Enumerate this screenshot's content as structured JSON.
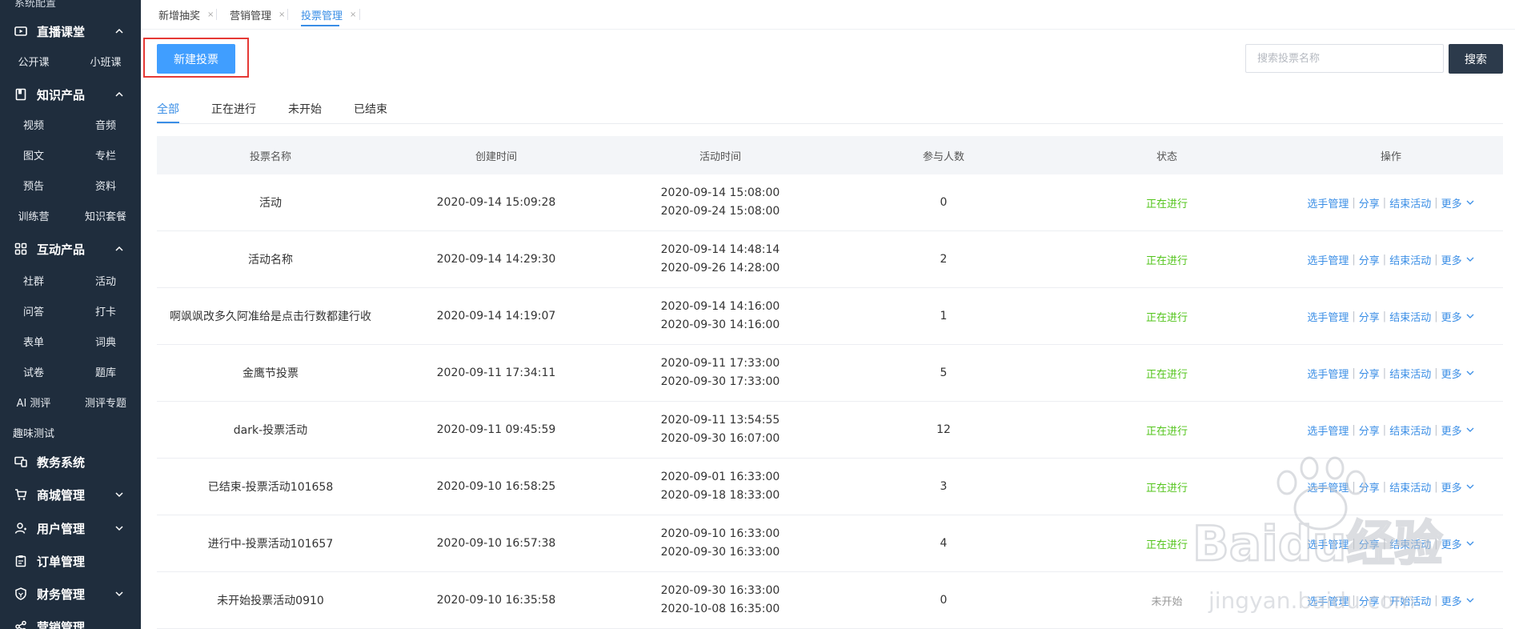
{
  "sidebar": {
    "top_cut_text": "系统配置",
    "sections": [
      {
        "label": "直播课堂",
        "icon": "video-icon",
        "expanded": true
      },
      {
        "label": "知识产品",
        "icon": "book-icon",
        "expanded": true
      },
      {
        "label": "互动产品",
        "icon": "grid-icon",
        "expanded": true
      },
      {
        "label": "教务系统",
        "icon": "monitor-icon",
        "expanded": false
      },
      {
        "label": "商城管理",
        "icon": "cart-icon",
        "expanded": false
      },
      {
        "label": "用户管理",
        "icon": "user-icon",
        "expanded": false
      },
      {
        "label": "订单管理",
        "icon": "clipboard-icon",
        "expanded": false
      },
      {
        "label": "财务管理",
        "icon": "shield-icon",
        "expanded": false
      },
      {
        "label": "营销管理",
        "icon": "share-icon",
        "expanded": true
      }
    ],
    "live_items": [
      "公开课",
      "小班课"
    ],
    "knowledge_items": [
      "视频",
      "音频",
      "图文",
      "专栏",
      "预告",
      "资料",
      "训练营",
      "知识套餐"
    ],
    "interactive_items": [
      "社群",
      "活动",
      "问答",
      "打卡",
      "表单",
      "词典",
      "试卷",
      "题库",
      "AI 测评",
      "测评专题"
    ],
    "fun_test": "趣味测试"
  },
  "page_tabs": [
    {
      "label": "新增抽奖",
      "close": "×"
    },
    {
      "label": "营销管理",
      "close": "×"
    },
    {
      "label": "投票管理",
      "close": "×",
      "active": true
    }
  ],
  "toolbar": {
    "new_button": "新建投票",
    "search_placeholder": "搜索投票名称",
    "search_button": "搜索"
  },
  "filter_tabs": [
    "全部",
    "正在进行",
    "未开始",
    "已结束"
  ],
  "table": {
    "headers": [
      "投票名称",
      "创建时间",
      "活动时间",
      "参与人数",
      "状态",
      "操作"
    ],
    "rows": [
      {
        "name": "活动",
        "created": "2020-09-14 15:09:28",
        "start": "2020-09-14 15:08:00",
        "end": "2020-09-24 15:08:00",
        "count": "0",
        "status": "正在进行",
        "status_type": "on",
        "ops": [
          "选手管理",
          "分享",
          "结束活动",
          "更多"
        ]
      },
      {
        "name": "活动名称",
        "created": "2020-09-14 14:29:30",
        "start": "2020-09-14 14:48:14",
        "end": "2020-09-26 14:28:00",
        "count": "2",
        "status": "正在进行",
        "status_type": "on",
        "ops": [
          "选手管理",
          "分享",
          "结束活动",
          "更多"
        ]
      },
      {
        "name": "啊飒飒改多久阿准给是点击行数都建行收",
        "created": "2020-09-14 14:19:07",
        "start": "2020-09-14 14:16:00",
        "end": "2020-09-30 14:16:00",
        "count": "1",
        "status": "正在进行",
        "status_type": "on",
        "ops": [
          "选手管理",
          "分享",
          "结束活动",
          "更多"
        ]
      },
      {
        "name": "金鹰节投票",
        "created": "2020-09-11 17:34:11",
        "start": "2020-09-11 17:33:00",
        "end": "2020-09-30 17:33:00",
        "count": "5",
        "status": "正在进行",
        "status_type": "on",
        "ops": [
          "选手管理",
          "分享",
          "结束活动",
          "更多"
        ]
      },
      {
        "name": "dark-投票活动",
        "created": "2020-09-11 09:45:59",
        "start": "2020-09-11 13:54:55",
        "end": "2020-09-30 16:07:00",
        "count": "12",
        "status": "正在进行",
        "status_type": "on",
        "ops": [
          "选手管理",
          "分享",
          "结束活动",
          "更多"
        ]
      },
      {
        "name": "已结束-投票活动101658",
        "created": "2020-09-10 16:58:25",
        "start": "2020-09-01 16:33:00",
        "end": "2020-09-18 18:33:00",
        "count": "3",
        "status": "正在进行",
        "status_type": "on",
        "ops": [
          "选手管理",
          "分享",
          "结束活动",
          "更多"
        ]
      },
      {
        "name": "进行中-投票活动101657",
        "created": "2020-09-10 16:57:38",
        "start": "2020-09-10 16:33:00",
        "end": "2020-09-30 16:33:00",
        "count": "4",
        "status": "正在进行",
        "status_type": "on",
        "ops": [
          "选手管理",
          "分享",
          "结束活动",
          "更多"
        ]
      },
      {
        "name": "未开始投票活动0910",
        "created": "2020-09-10 16:35:58",
        "start": "2020-09-30 16:33:00",
        "end": "2020-10-08 16:35:00",
        "count": "0",
        "status": "未开始",
        "status_type": "wait",
        "ops": [
          "选手管理",
          "分享",
          "开始活动",
          "更多"
        ]
      }
    ]
  },
  "watermark": {
    "text": "Baidu经验",
    "sub": "jingyan.baidu.com"
  },
  "colors": {
    "sidebar": "#1f2d3d",
    "accent": "#409eff",
    "link": "#3a8ee6",
    "status_on": "#52c41a",
    "highlight": "#e53935"
  }
}
